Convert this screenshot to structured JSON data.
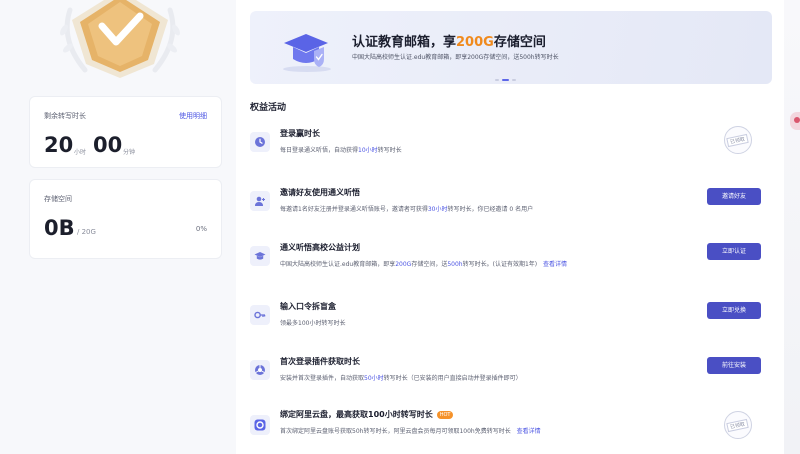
{
  "left": {
    "badge": {
      "icon": "shield-check-badge-icon",
      "color": "#e6b368"
    },
    "time_card": {
      "label": "剩余转写时长",
      "link": "使用明细",
      "hours": "20",
      "hours_unit": "小时",
      "minutes": "00",
      "minutes_unit": "分钟"
    },
    "storage_card": {
      "label": "存储空间",
      "used": "0B",
      "total": "/ 20G",
      "percent": "0%"
    }
  },
  "banner": {
    "title_prefix": "认证教育邮箱，享",
    "title_highlight": "200G",
    "title_suffix": "存储空间",
    "subtitle": "中国大陆高校师生认证.edu教育邮箱，即享200G存储空间，送500h转写时长",
    "icon": "graduation-cap-shield-icon",
    "slides": 3,
    "active_slide": 2
  },
  "section_title": "权益活动",
  "tasks": [
    {
      "icon": "clock-icon",
      "title": "登录赢时长",
      "desc_a": "每日登录通义听悟，自动获得",
      "desc_hl": "10小时",
      "desc_b": "转写时长",
      "status": "stamp",
      "stamp_label": "已领取"
    },
    {
      "icon": "invite-user-icon",
      "title": "邀请好友使用通义听悟",
      "desc_a": "每邀请1名好友注册并登录通义听悟账号，邀请者可获得",
      "desc_hl": "30小时",
      "desc_b": "转写时长，你已经邀请 0 名用户",
      "status": "button",
      "button_label": "邀请好友"
    },
    {
      "icon": "graduation-cap-icon",
      "title": "通义听悟高校公益计划",
      "desc_a": "中国大陆高校师生认证.edu教育邮箱，即享",
      "desc_hl": "200G",
      "desc_b": "存储空间，送",
      "desc_hl2": "500h",
      "desc_c": "转写时长。(认证有效期1年)",
      "link": "查看详情",
      "status": "button",
      "button_label": "立即认证"
    },
    {
      "icon": "key-icon",
      "title": "输入口令拆盲盒",
      "desc_a": "领最多100小时转写时长",
      "status": "button",
      "button_label": "立即兑换"
    },
    {
      "icon": "browser-plugin-icon",
      "title": "首次登录插件获取时长",
      "desc_a": "安装并首次登录插件，自动获取",
      "desc_hl": "50小时",
      "desc_b": "转写时长（已安装的用户直接启动并登录插件即可）",
      "status": "button",
      "button_label": "前往安装"
    },
    {
      "icon": "aliyun-drive-icon",
      "title": "绑定阿里云盘，最高获取100小时转写时长",
      "hot": "HOT",
      "desc_a": "首次绑定阿里云盘账号获取50h转写时长，阿里云盘会员每月可领取100h免费转写时长",
      "link": "查看详情",
      "status": "stamp",
      "stamp_label": "已领取"
    }
  ],
  "colors": {
    "accent": "#4a4fc4",
    "link": "#4c55e3",
    "highlight": "#f08a1d"
  }
}
